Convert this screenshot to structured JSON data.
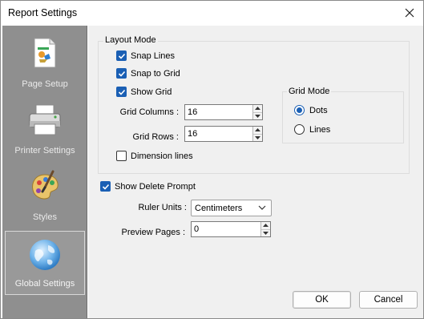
{
  "window": {
    "title": "Report Settings"
  },
  "sidebar": {
    "items": [
      {
        "label": "Page Setup"
      },
      {
        "label": "Printer Settings"
      },
      {
        "label": "Styles"
      },
      {
        "label": "Global Settings",
        "active": true
      }
    ]
  },
  "layout_mode": {
    "legend": "Layout Mode",
    "snap_lines": "Snap Lines",
    "snap_to_grid": "Snap to Grid",
    "show_grid": "Show Grid",
    "grid_columns_label": "Grid Columns :",
    "grid_columns_value": "16",
    "grid_rows_label": "Grid Rows :",
    "grid_rows_value": "16",
    "dimension_lines": "Dimension lines"
  },
  "grid_mode": {
    "legend": "Grid Mode",
    "dots": "Dots",
    "lines": "Lines",
    "selected": "Dots"
  },
  "general": {
    "show_delete_prompt": "Show Delete Prompt",
    "ruler_units_label": "Ruler Units :",
    "ruler_units_value": "Centimeters",
    "preview_pages_label": "Preview Pages :",
    "preview_pages_value": "0"
  },
  "buttons": {
    "ok": "OK",
    "cancel": "Cancel"
  },
  "colors": {
    "accent": "#1a5fb4",
    "sidebar": "#8f8f8f",
    "panel": "#f0f0f0"
  }
}
